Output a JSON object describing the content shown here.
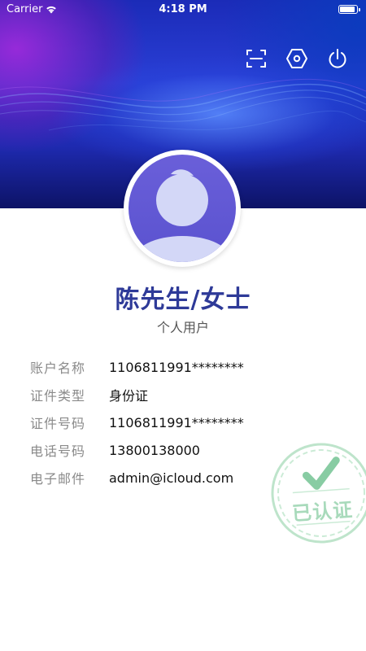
{
  "status_bar": {
    "carrier": "Carrier",
    "time": "4:18 PM"
  },
  "header": {
    "icons": [
      "scan-icon",
      "settings-icon",
      "power-icon"
    ]
  },
  "profile": {
    "name": "陈先生/女士",
    "type": "个人用户"
  },
  "info": {
    "rows": [
      {
        "label": "账户名称",
        "value": "1106811991********"
      },
      {
        "label": "证件类型",
        "value": "身份证"
      },
      {
        "label": "证件号码",
        "value": "1106811991********"
      },
      {
        "label": "电话号码",
        "value": "13800138000"
      },
      {
        "label": "电子邮件",
        "value": "admin@icloud.com"
      }
    ]
  },
  "stamp": {
    "text": "已认证"
  },
  "colors": {
    "name": "#2e3a98",
    "stamp": "#9fd6b4",
    "label": "#8a8a8a"
  }
}
